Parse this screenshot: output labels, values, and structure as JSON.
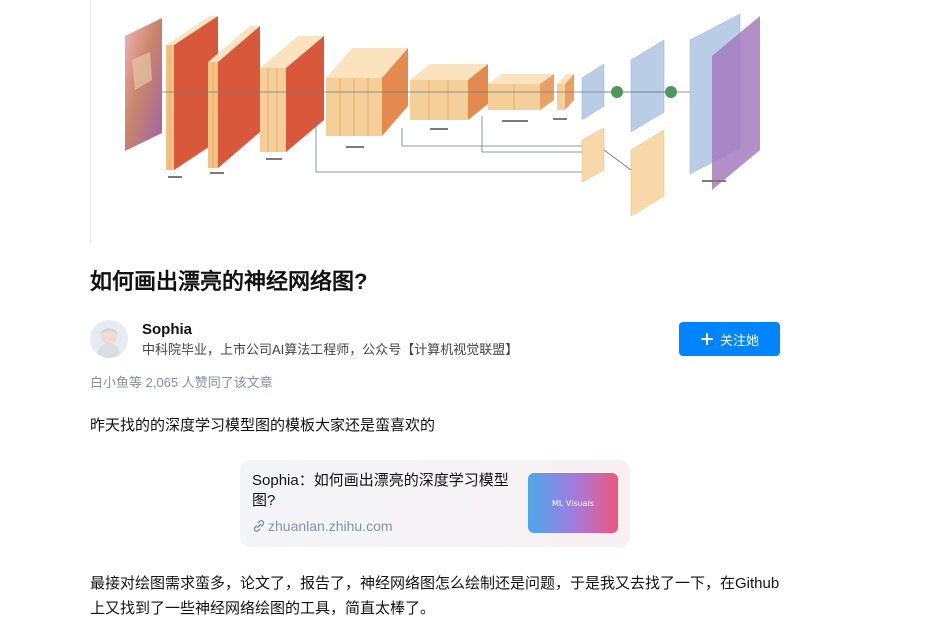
{
  "article": {
    "title": "如何画出漂亮的神经网络图?",
    "author": {
      "name": "Sophia",
      "bio": "中科院毕业，上市公司AI算法工程师，公众号【计算机视觉联盟】",
      "follow_label": "关注她"
    },
    "likes_text": "白小鱼等 2,065 人赞同了该文章",
    "paragraph1": "昨天找的的深度学习模型图的模板大家还是蛮喜欢的",
    "link_card": {
      "title": "Sophia：如何画出漂亮的深度学习模型图?",
      "url": "zhuanlan.zhihu.com",
      "thumb_text": "ML Visuals"
    },
    "paragraph2": "最接对绘图需求蛮多，论文了，报告了，神经网络图怎么绘制还是问题，于是我又去找了一下，在Github上又找到了一些神经网络绘图的工具，简直太棒了。"
  },
  "icons": {
    "follow": "plus-icon",
    "link": "link-icon"
  },
  "colors": {
    "accent": "#0084ff",
    "meta_text": "#8590a6",
    "layer_orange": "#f5cf9a",
    "layer_red": "#d9573a",
    "layer_blue": "#b9cde6",
    "layer_purple": "#a47bbd",
    "node_green": "#4a9a5a"
  }
}
